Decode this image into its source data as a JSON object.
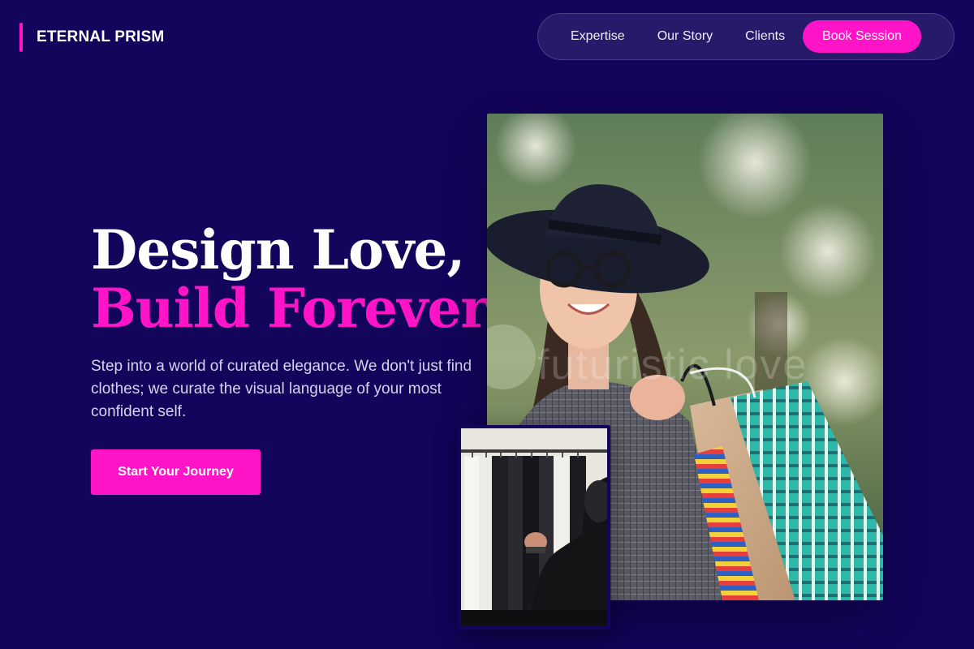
{
  "header": {
    "brand": "ETERNAL PRISM",
    "nav": [
      {
        "label": "Expertise"
      },
      {
        "label": "Our Story"
      },
      {
        "label": "Clients"
      }
    ],
    "cta_label": "Book Session"
  },
  "hero": {
    "title_line1": "Design Love,",
    "title_line2": "Build Forever.",
    "subtitle": "Step into a world of curated elegance. We don't just find clothes; we curate the visual language of your most confident self.",
    "cta_label": "Start Your Journey"
  },
  "images": {
    "main_watermark": "futuristic love",
    "main_alt": "woman-with-shopping-bags",
    "small_alt": "clothing-rack"
  },
  "colors": {
    "background": "#13045c",
    "accent": "#ff14c8",
    "text": "#ffffff",
    "muted_text": "#d8d4ee"
  }
}
